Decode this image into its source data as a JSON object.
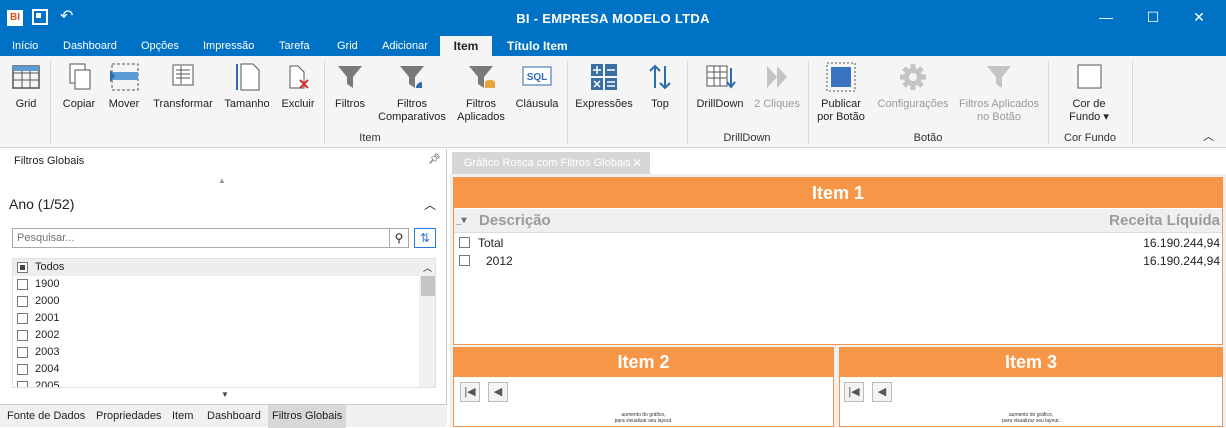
{
  "app": {
    "icon_label": "BI",
    "title": "BI - EMPRESA MODELO LTDA",
    "accent_color": "#0072c6",
    "window_controls": {
      "minimize": "—",
      "maximize": "☐",
      "close": "✕"
    }
  },
  "tabs": [
    "Início",
    "Dashboard",
    "Opções",
    "Impressão",
    "Tarefa",
    "Grid",
    "Adicionar",
    "Item",
    "Título Item"
  ],
  "ribbon": {
    "buttons": [
      {
        "label": "Grid",
        "icon": "grid-icon"
      },
      {
        "label": "Copiar",
        "icon": "copy-icon"
      },
      {
        "label": "Mover",
        "icon": "move-icon"
      },
      {
        "label": "Transformar",
        "icon": "transform-icon"
      },
      {
        "label": "Tamanho",
        "icon": "size-icon"
      },
      {
        "label": "Excluir",
        "icon": "delete-icon"
      },
      {
        "label": "Filtros",
        "icon": "filter-icon"
      },
      {
        "label": "Filtros\nComparativos",
        "icon": "filter-compare-icon"
      },
      {
        "label": "Filtros\nAplicados",
        "icon": "filter-applied-icon"
      },
      {
        "label": "Cláusula",
        "icon": "sql-icon"
      },
      {
        "label": "Expressões",
        "icon": "calculator-icon"
      },
      {
        "label": "Top",
        "icon": "sort-icon"
      },
      {
        "label": "DrillDown",
        "icon": "drilldown-icon"
      },
      {
        "label": "2 Cliques",
        "icon": "double-arrow-icon"
      },
      {
        "label": "Publicar\npor Botão",
        "icon": "publish-icon"
      },
      {
        "label": "Configurações",
        "icon": "gear-icon"
      },
      {
        "label": "Filtros Aplicados\nno Botão",
        "icon": "filter-button-icon"
      },
      {
        "label": "Cor de\nFundo",
        "icon": "background-color-icon"
      }
    ],
    "groups": [
      "Item",
      "DrillDown",
      "Botão",
      "Cor Fundo"
    ],
    "sql_text": "SQL"
  },
  "left_panel": {
    "title": "Filtros Globais",
    "section_title": "Ano (1/52)",
    "search_placeholder": "Pesquisar...",
    "items": [
      "Todos",
      "1900",
      "2000",
      "2001",
      "2002",
      "2003",
      "2004",
      "2005"
    ]
  },
  "bottom_tabs": [
    "Fonte de Dados",
    "Propriedades",
    "Item",
    "Dashboard",
    "Filtros Globais"
  ],
  "document": {
    "tab_title": "Gráfico Rosca com Filtros Globais",
    "card1": {
      "title": "Item 1",
      "col_desc": "Descrição",
      "col_value": "Receita Líquida",
      "rows": [
        {
          "label": "Total",
          "value": "16.190.244,94"
        },
        {
          "label": "2012",
          "value": "16.190.244,94"
        }
      ]
    },
    "card2": {
      "title": "Item 2",
      "msg1": "aumento do gráfico,",
      "msg2": "para visualizar seu layout."
    },
    "card3": {
      "title": "Item 3",
      "msg1": "aumento do gráfico,",
      "msg2": "para visualizar seu layout."
    },
    "accent": "#f79646"
  }
}
